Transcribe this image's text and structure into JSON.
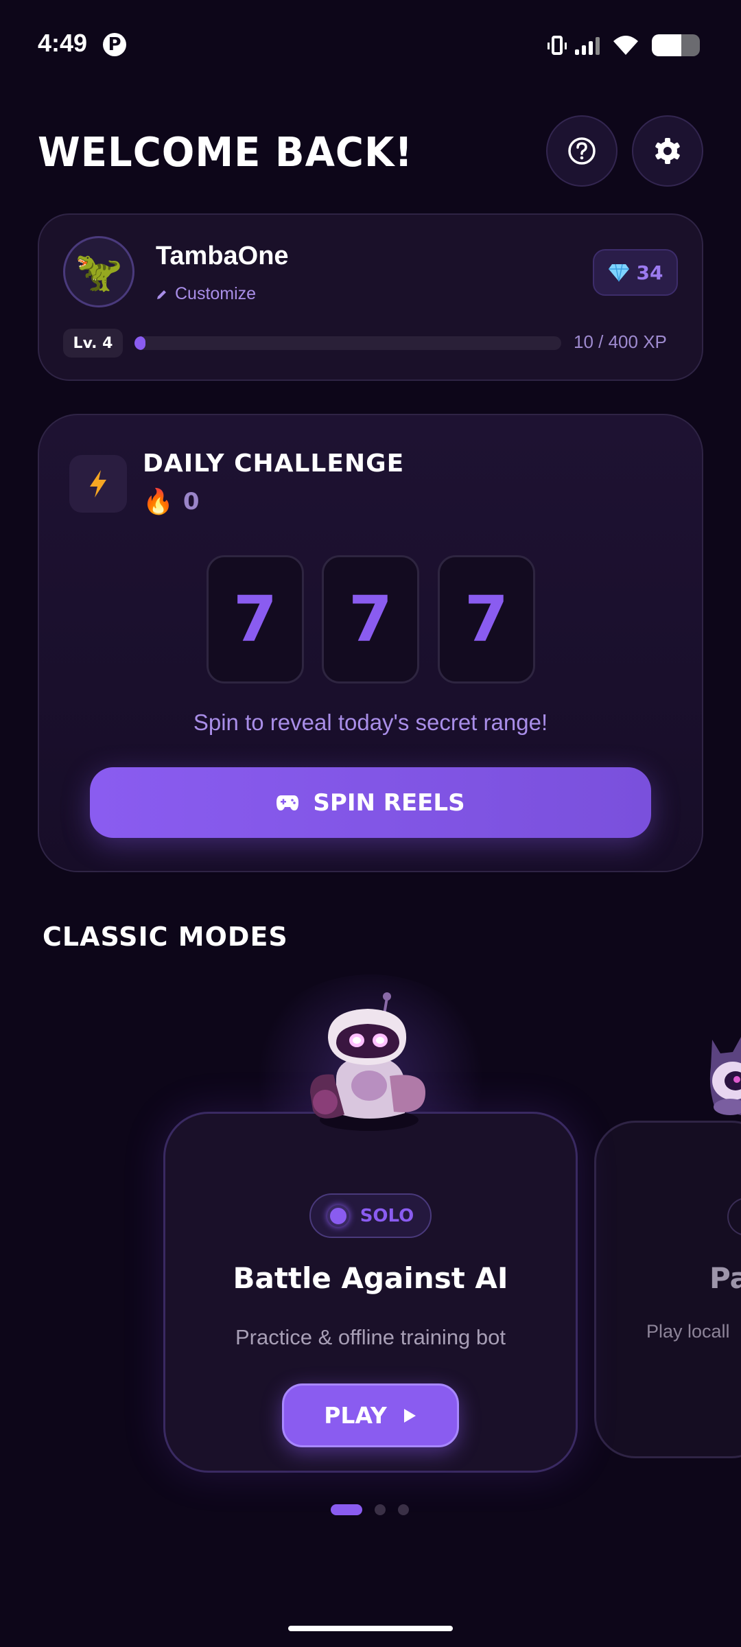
{
  "status_bar": {
    "time": "4:49",
    "pinterest_icon": "pinterest-icon",
    "icons": [
      "vibrate-icon",
      "signal-icon",
      "wifi-icon",
      "battery-icon"
    ],
    "battery_level": 0.62
  },
  "header": {
    "title": "WELCOME BACK!",
    "help_icon": "question-circle-icon",
    "settings_icon": "gear-icon"
  },
  "profile": {
    "username": "TambaOne",
    "customize_label": "Customize",
    "avatar_icon": "dinosaur-icon",
    "gems": "34",
    "level_label": "Lv. 4",
    "xp_text": "10 / 400 XP",
    "xp_progress": 0.025
  },
  "daily": {
    "title": "DAILY CHALLENGE",
    "streak_count": "0",
    "reels": [
      "7",
      "7",
      "7"
    ],
    "hint": "Spin to reveal today's secret range!",
    "spin_label": "SPIN REELS"
  },
  "classic": {
    "section_title": "CLASSIC MODES",
    "cards": [
      {
        "chip": "SOLO",
        "title": "Battle Against AI",
        "description": "Practice & offline training bot",
        "play_label": "PLAY"
      },
      {
        "title": "Pa",
        "description": "Play locall"
      }
    ],
    "page_count": 3,
    "active_page": 0
  },
  "colors": {
    "background": "#0d0619",
    "accent": "#8a5cf0",
    "card": "#1a1029"
  }
}
